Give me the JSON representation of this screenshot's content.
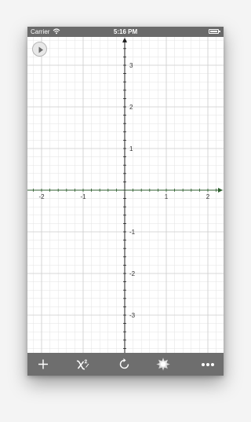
{
  "status_bar": {
    "carrier": "Carrier",
    "time": "5:16 PM"
  },
  "graph": {
    "x_tick_labels": [
      "-2",
      "-1",
      "1",
      "2"
    ],
    "y_tick_labels": [
      "3",
      "2",
      "1",
      "-1",
      "-2",
      "-3"
    ],
    "axis_color": "#2f5f2f",
    "grid_color": "#e3e3e3"
  },
  "toolbar": {
    "items": [
      "add-icon",
      "function-icon",
      "refresh-icon",
      "settings-icon",
      "more-icon"
    ]
  },
  "colors": {
    "status_bar_bg": "#6a6a6a",
    "toolbar_bg": "#6e6e6e"
  }
}
